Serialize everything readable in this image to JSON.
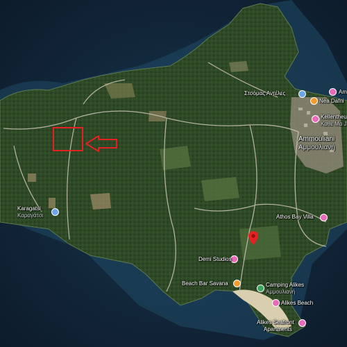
{
  "colors": {
    "sea_deep": "#0d1b2b",
    "sea_shallow": "#1f4a66",
    "land": "#2f4a26",
    "land_light": "#4c6a3a",
    "road": "#c9c3b4",
    "marker_red": "#e52222",
    "poi_pink": "#e86ab8",
    "poi_blue": "#6aa6e8",
    "poi_orange": "#f29b2f",
    "poi_green": "#3aa55c"
  },
  "labels": {
    "amm_top": "Amm",
    "stsomas": "Στσόμας Αντέλες",
    "nea_dafni": "Nea Dafni",
    "kehen": "Kellentheus",
    "kehen2": "Καθε Μα Ju",
    "ammouliani": "Ammouliani",
    "ammouliani_greek": "Αμμουλιανή",
    "karagatsi": "Karagatsi",
    "karagatsi_greek": "Καραγάτσι",
    "athos_bay": "Athos Bay Villa",
    "demi_studios": "Demi Studios",
    "beach_bar": "Beach Bar Savana",
    "camping": "Camping Alikes",
    "camping_greek": "Αμμουλιανή",
    "alikes_beach": "Alikes Beach",
    "alikes_seafront": "Alikes Seafront",
    "apartments": "Apartments"
  },
  "icons": {
    "highlight": "red-rectangle-outline",
    "arrow": "red-arrow-left-icon",
    "location_pin": "red-map-pin-icon",
    "poi": "map-poi-icon"
  }
}
